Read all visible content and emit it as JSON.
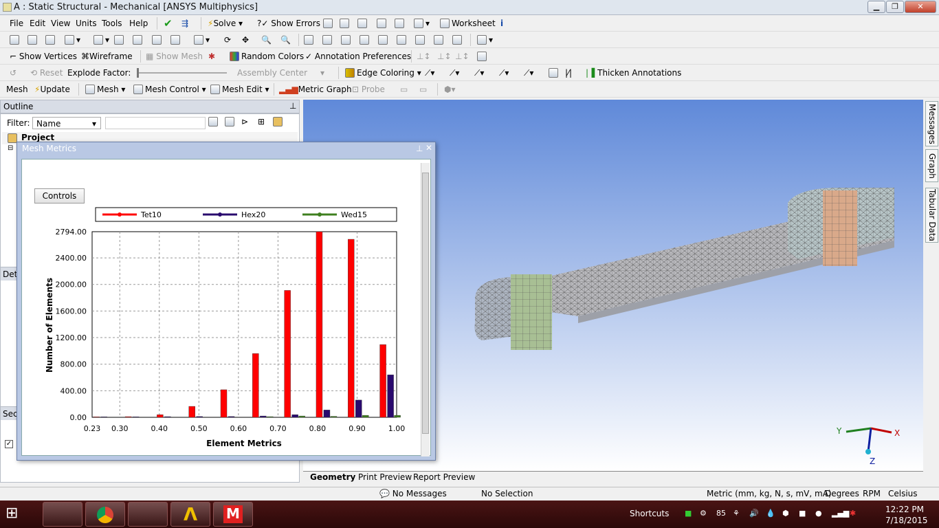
{
  "window": {
    "title": "A : Static Structural - Mechanical [ANSYS Multiphysics]",
    "min": "▁",
    "max": "❐",
    "close": "✕"
  },
  "menu": [
    "File",
    "Edit",
    "View",
    "Units",
    "Tools",
    "Help"
  ],
  "toolbar1": {
    "solve": "Solve",
    "show_errors": "Show Errors",
    "worksheet": "Worksheet"
  },
  "toolbar3": {
    "show_vertices": "Show Vertices",
    "wireframe": "Wireframe",
    "show_mesh": "Show Mesh",
    "random_colors": "Random Colors",
    "annotation_prefs": "Annotation Preferences"
  },
  "toolbar4": {
    "reset": "Reset",
    "explode_factor": "Explode Factor:",
    "assembly_center": "Assembly Center",
    "edge_coloring": "Edge Coloring",
    "thicken": "Thicken Annotations"
  },
  "toolbar5": {
    "mesh": "Mesh",
    "update": "Update",
    "mesh_menu": "Mesh",
    "mesh_control": "Mesh Control",
    "mesh_edit": "Mesh Edit",
    "metric_graph": "Metric Graph",
    "probe": "Probe"
  },
  "outline": {
    "title": "Outline",
    "filter_label": "Filter:",
    "filter_value": "Name",
    "project": "Project",
    "details_fragment": "Det",
    "section_fragment": "Sec"
  },
  "mesh_metrics": {
    "title": "Mesh Metrics",
    "controls": "Controls"
  },
  "chart_data": {
    "type": "bar",
    "xlabel": "Element Metrics",
    "ylabel": "Number of Elements",
    "ylim": [
      0,
      2794
    ],
    "xlim": [
      0.23,
      1.0
    ],
    "y_ticks": [
      "2794.00",
      "2400.00",
      "2000.00",
      "1600.00",
      "1200.00",
      "800.00",
      "400.00",
      "0.00"
    ],
    "y_tick_values": [
      2794,
      2400,
      2000,
      1600,
      1200,
      800,
      400,
      0
    ],
    "x_ticks": [
      "0.23",
      "0.30",
      "0.40",
      "0.50",
      "0.60",
      "0.70",
      "0.80",
      "0.90",
      "1.00"
    ],
    "x_tick_values": [
      0.23,
      0.3,
      0.4,
      0.5,
      0.6,
      0.7,
      0.8,
      0.9,
      1.0
    ],
    "legend": "top",
    "grid": true,
    "bin_centers": [
      0.253,
      0.302,
      0.4,
      0.499,
      0.598,
      0.697,
      0.796,
      0.896,
      0.974
    ],
    "series": [
      {
        "name": "Tet10",
        "color": "#ff0000",
        "values": [
          8,
          10,
          40,
          165,
          415,
          960,
          1910,
          2794,
          2680,
          1095
        ]
      },
      {
        "name": "Hex20",
        "color": "#2a0a6e",
        "values": [
          8,
          8,
          10,
          12,
          12,
          20,
          40,
          110,
          260,
          640
        ]
      },
      {
        "name": "Wed15",
        "color": "#3f7f1f",
        "values": [
          0,
          0,
          0,
          0,
          0,
          10,
          20,
          15,
          30,
          30
        ]
      }
    ]
  },
  "right_tabs": [
    "Messages",
    "Graph",
    "Tabular Data"
  ],
  "bottom_tabs": [
    "Geometry",
    "Print Preview",
    "Report Preview"
  ],
  "status": {
    "messages": "No Messages",
    "selection": "No Selection",
    "units": "Metric (mm, kg, N, s, mV, mA)",
    "degrees": "Degrees",
    "rpm": "RPM",
    "temp": "Celsius"
  },
  "axes_labels": {
    "x": "X",
    "y": "Y",
    "z": "Z"
  },
  "taskbar": {
    "shortcuts": "Shortcuts",
    "battery": "85",
    "time": "12:22 PM",
    "date": "7/18/2015"
  }
}
